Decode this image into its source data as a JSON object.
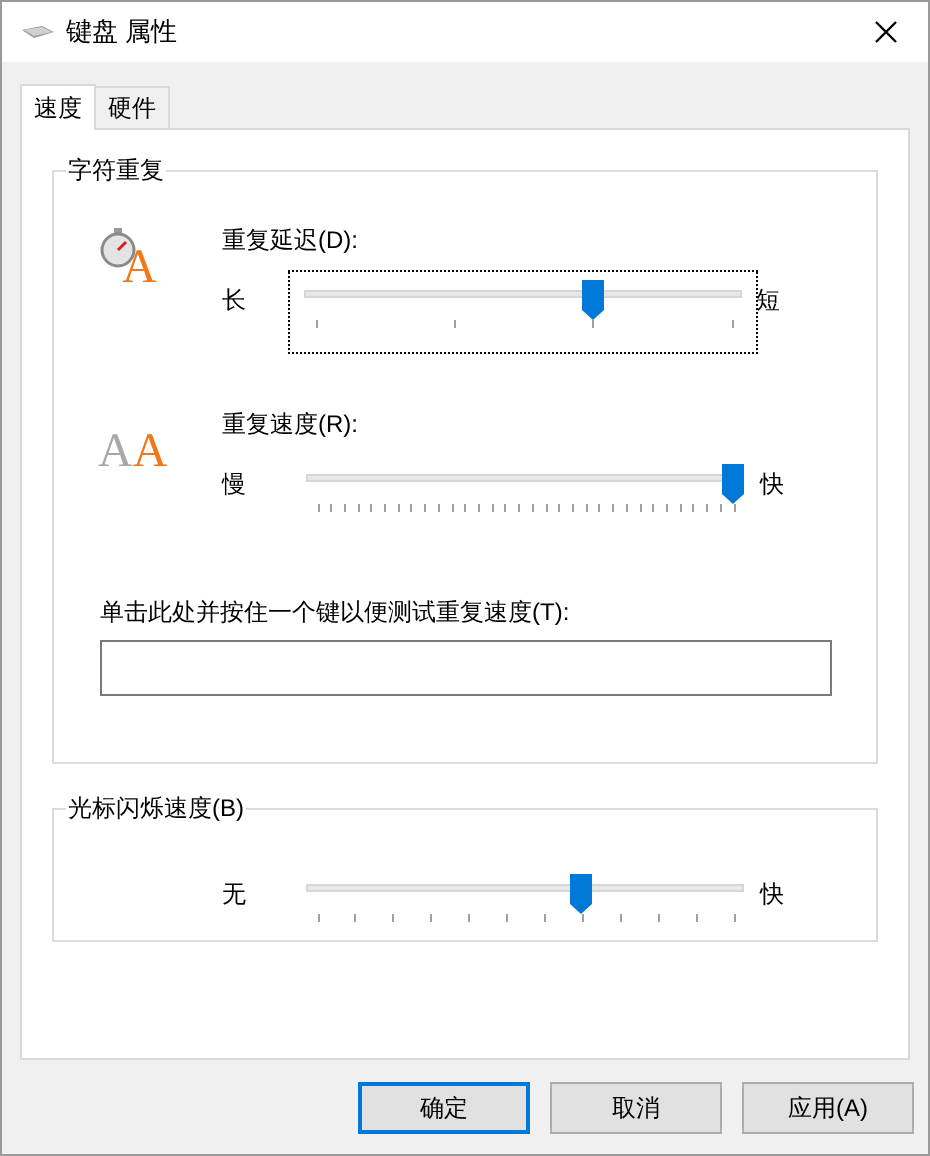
{
  "window": {
    "title": "键盘 属性"
  },
  "tabs": [
    {
      "label": "速度",
      "selected": true
    },
    {
      "label": "硬件",
      "selected": false
    }
  ],
  "character_repeat": {
    "title": "字符重复",
    "repeat_delay": {
      "label": "重复延迟(D):",
      "icon_letters": [
        "A"
      ],
      "min_label": "长",
      "max_label": "短",
      "level": 0.667,
      "focused": true
    },
    "repeat_rate": {
      "label": "重复速度(R):",
      "icon_letters": [
        "A",
        "A"
      ],
      "min_label": "慢",
      "max_label": "快",
      "level": 1,
      "focused": false
    },
    "test": {
      "label": "单击此处并按住一个键以便测试重复速度(T):"
    }
  },
  "cursor_blink": {
    "title": "光标闪烁速度(B)",
    "min_label": "无",
    "max_label": "快",
    "level": 0.636
  },
  "buttons": [
    {
      "label": "确定",
      "default": true
    },
    {
      "label": "取消",
      "default": false
    },
    {
      "label": "应用(A)",
      "default": false
    }
  ]
}
